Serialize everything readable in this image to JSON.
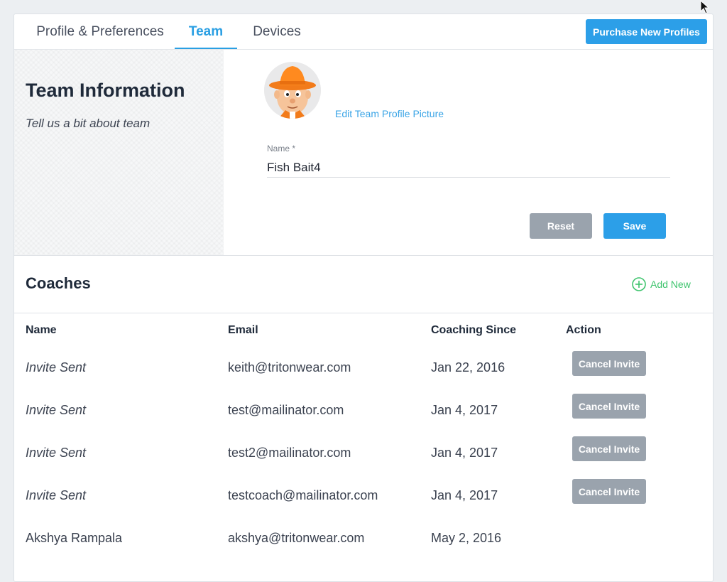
{
  "tabs": [
    {
      "label": "Profile & Preferences"
    },
    {
      "label": "Team"
    },
    {
      "label": "Devices"
    }
  ],
  "active_tab": "Team",
  "purchase_button": "Purchase New Profiles",
  "team_info": {
    "title": "Team Information",
    "subtitle": "Tell us a bit about team",
    "edit_picture_link": "Edit Team Profile Picture",
    "name_label": "Name *",
    "name_value": "Fish Bait4",
    "reset_label": "Reset",
    "save_label": "Save"
  },
  "coaches": {
    "title": "Coaches",
    "add_new_label": "Add New",
    "columns": [
      "Name",
      "Email",
      "Coaching Since",
      "Action"
    ],
    "rows": [
      {
        "name": "Invite Sent",
        "email": "keith@tritonwear.com",
        "since": "Jan 22, 2016",
        "action": "Cancel Invite"
      },
      {
        "name": "Invite Sent",
        "email": "test@mailinator.com",
        "since": "Jan 4, 2017",
        "action": "Cancel Invite"
      },
      {
        "name": "Invite Sent",
        "email": "test2@mailinator.com",
        "since": "Jan 4, 2017",
        "action": "Cancel Invite"
      },
      {
        "name": "Invite Sent",
        "email": "testcoach@mailinator.com",
        "since": "Jan 4, 2017",
        "action": "Cancel Invite"
      },
      {
        "name": "Akshya Rampala",
        "email": "akshya@tritonwear.com",
        "since": "May 2, 2016",
        "action": ""
      }
    ]
  },
  "colors": {
    "accent": "#2c9fe8",
    "add_new": "#3ec46d",
    "muted_button": "#9aa3ad"
  },
  "icons": {
    "add": "plus-circle-icon",
    "cursor": "mouse-pointer-icon"
  }
}
